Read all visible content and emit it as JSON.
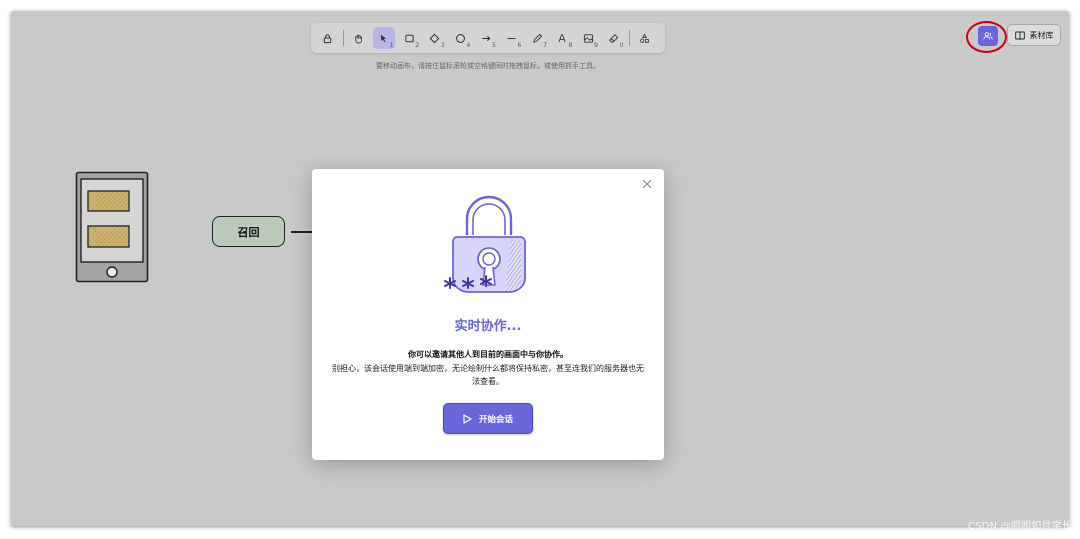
{
  "toolbar": {
    "tools": [
      {
        "icon": "lock-icon",
        "num": ""
      },
      {
        "icon": "hand-icon",
        "num": ""
      },
      {
        "icon": "pointer-icon",
        "num": "1",
        "active": true
      },
      {
        "icon": "rectangle-icon",
        "num": "2"
      },
      {
        "icon": "diamond-icon",
        "num": "3"
      },
      {
        "icon": "ellipse-icon",
        "num": "4"
      },
      {
        "icon": "arrow-icon",
        "num": "5"
      },
      {
        "icon": "line-icon",
        "num": "6"
      },
      {
        "icon": "pencil-icon",
        "num": "7"
      },
      {
        "icon": "text-icon",
        "num": "8"
      },
      {
        "icon": "image-icon",
        "num": "9"
      },
      {
        "icon": "eraser-icon",
        "num": "0"
      },
      {
        "icon": "shapes-icon",
        "num": ""
      }
    ],
    "hint": "要移动画布，请按住鼠标滚轮或空格键同时拖拽鼠标，或使用抓手工具。"
  },
  "top_right": {
    "library_label": "素材库"
  },
  "canvas": {
    "recall_label": "召回"
  },
  "modal": {
    "title": "实时协作...",
    "line1": "你可以邀请其他人到目前的画面中与你协作。",
    "line2": "别担心，该会话使用端到端加密，无论绘制什么都将保持私密，甚至连我们的服务器也无法查看。",
    "start_button": "开始会话",
    "close_icon": "close-icon"
  },
  "colors": {
    "accent": "#6965db",
    "annotation_ring": "#c8000f",
    "canvas_bg": "#c9c9c9"
  },
  "watermark": "CSDN @明明如月学长"
}
